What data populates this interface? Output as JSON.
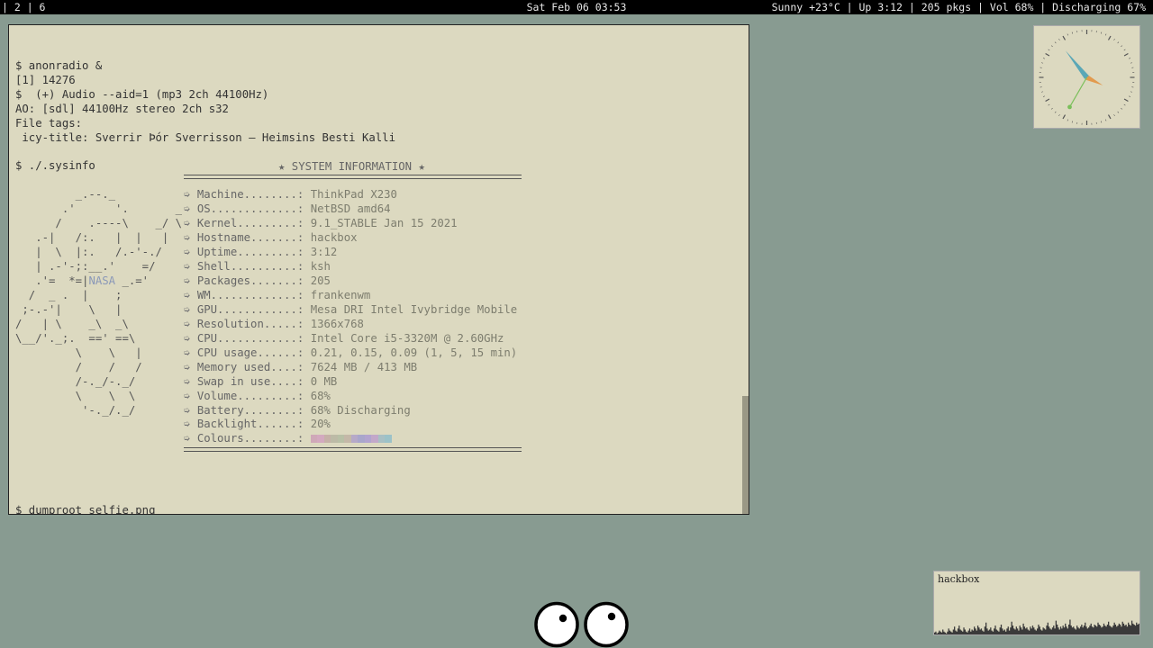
{
  "topbar": {
    "workspaces": "| 2 | 6",
    "datetime": "Sat Feb 06 03:53",
    "status": "Sunny +23°C | Up 3:12 | 205 pkgs | Vol 68% | Discharging 67%"
  },
  "terminal": {
    "lines": [
      "$ anonradio &",
      "[1] 14276",
      "$  (+) Audio --aid=1 (mp3 2ch 44100Hz)",
      "AO: [sdl] 44100Hz stereo 2ch s32",
      "File tags:",
      " icy-title: Sverrir Þór Sverrisson – Heimsins Besti Kalli",
      "",
      "$ ./.sysinfo"
    ],
    "sysinfo_title": "★ SYSTEM INFORMATION ★",
    "ascii_art": {
      "before_logo": "         _.--._\n       .'      '.       _\n      /    .----\\    _/ \\\n   .-|   /:.   |  |   |\n   |  \\  |:.   /.-'-./\n   | .-'-;:__.'    =/\n   .'=  *=|",
      "logo": "NASA",
      "after_logo": " _.='\n  /  _ .  |    ;\n ;-.-'|    \\   |\n/   | \\    _\\  _\\\n\\__/'._;.  ==' ==\\\n         \\    \\   |\n         /    /   /\n         /-._/-._/\n         \\    \\  \\\n          '-._/._/"
    },
    "info": [
      {
        "key": "Machine........",
        "value": "ThinkPad X230"
      },
      {
        "key": "OS.............",
        "value": "NetBSD amd64"
      },
      {
        "key": "Kernel.........",
        "value": "9.1_STABLE Jan 15 2021"
      },
      {
        "key": "Hostname.......",
        "value": "hackbox"
      },
      {
        "key": "Uptime.........",
        "value": "3:12"
      },
      {
        "key": "Shell..........",
        "value": "ksh"
      },
      {
        "key": "Packages.......",
        "value": "205"
      },
      {
        "key": "WM.............",
        "value": "frankenwm"
      },
      {
        "key": "GPU............",
        "value": "Mesa DRI Intel Ivybridge Mobile"
      },
      {
        "key": "Resolution.....",
        "value": "1366x768"
      },
      {
        "key": "CPU............",
        "value": "Intel Core i5-3320M @ 2.60GHz"
      },
      {
        "key": "CPU usage......",
        "value": "0.21, 0.15, 0.09 (1, 5, 15 min)"
      },
      {
        "key": "Memory used....",
        "value": "7624 MB / 413 MB"
      },
      {
        "key": "Swap in use....",
        "value": "0 MB"
      },
      {
        "key": "Volume.........",
        "value": "68%"
      },
      {
        "key": "Battery........",
        "value": "68% Discharging"
      },
      {
        "key": "Backlight......",
        "value": "20%"
      },
      {
        "key": "Colours........",
        "value": ""
      }
    ],
    "bullet": "➭",
    "key_suffix": ": ",
    "colour_swatches": [
      "#cfa8b8",
      "#d3a9bf",
      "#c6b1a8",
      "#bcbaa6",
      "#b8c0a6",
      "#c4b8a8",
      "#b6a9c8",
      "#a9a6cb",
      "#b2a4cf",
      "#c2a8c9",
      "#a8c0c4",
      "#9cc2c8"
    ],
    "prompt_line": "$ dumproot selfie.png"
  },
  "clock": {
    "hour": 3,
    "minute": 53,
    "second": 35,
    "hand_colors": {
      "hour": "#e29a4e",
      "minute": "#5aa7b6",
      "second": "#7abf5a"
    }
  },
  "loadgraph": {
    "host": "hackbox",
    "samples": [
      2,
      3,
      1,
      2,
      4,
      3,
      2,
      5,
      3,
      2,
      1,
      3,
      6,
      4,
      3,
      2,
      5,
      8,
      4,
      3,
      6,
      9,
      5,
      4,
      3,
      7,
      5,
      3,
      2,
      4,
      6,
      3,
      5,
      4,
      8,
      6,
      4,
      9,
      7,
      5,
      6,
      4,
      3,
      8,
      12,
      6,
      4,
      5,
      7,
      4,
      3,
      6,
      9,
      5,
      4,
      3,
      7,
      10,
      6,
      4,
      5,
      3,
      6,
      8,
      4,
      7,
      13,
      9,
      6,
      5,
      8,
      6,
      4,
      9,
      7,
      5,
      11,
      8,
      6,
      7,
      5,
      4,
      8,
      6,
      9,
      7,
      5,
      4,
      6,
      10,
      8,
      5,
      4,
      7,
      6,
      5,
      9,
      12,
      8,
      6,
      5,
      7,
      9,
      6,
      14,
      10,
      7,
      5,
      8,
      6,
      9,
      7,
      11,
      8,
      6,
      10,
      15,
      9,
      7,
      8,
      6,
      5,
      9,
      7,
      6,
      8,
      10,
      7,
      9,
      12,
      8,
      6,
      7,
      9,
      11,
      8,
      7,
      10,
      9,
      8,
      12,
      10,
      9,
      7,
      8,
      11,
      9,
      8,
      10,
      13,
      9,
      8,
      7,
      9,
      12,
      10,
      8,
      9,
      11,
      10,
      8,
      13,
      11,
      9,
      10,
      8,
      12,
      10,
      9,
      14,
      11,
      10,
      9,
      12,
      10,
      11
    ]
  }
}
